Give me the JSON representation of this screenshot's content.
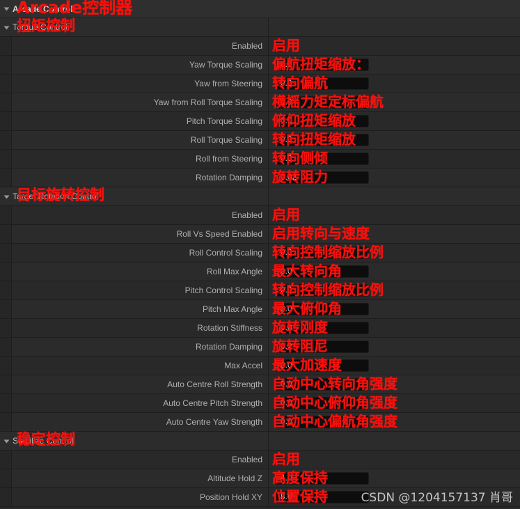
{
  "panel": {
    "title": "Arcade Control",
    "accent_annotation_color": "#f5110d",
    "background_color": "#282828",
    "field_background_color": "#0d0d0d"
  },
  "root": {
    "label": "Arcade Control",
    "annotation": "Arcade控制器",
    "expanded": true,
    "twisty_icon": "triangle-down-icon"
  },
  "rows": [
    {
      "kind": "category",
      "label": "Torque Control",
      "annotation": "扭矩控制",
      "twisty_icon": "triangle-down-icon",
      "control": "none",
      "value": ""
    },
    {
      "kind": "property",
      "label": "Enabled",
      "annotation": "启用",
      "control": "checkbox",
      "checked": false,
      "value": ""
    },
    {
      "kind": "property",
      "label": "Yaw Torque Scaling",
      "annotation": "偏航扭矩缩放：",
      "control": "number",
      "value": "0.0"
    },
    {
      "kind": "property",
      "label": "Yaw from Steering",
      "annotation": "转向偏航",
      "control": "number",
      "value": "0.0"
    },
    {
      "kind": "property",
      "label": "Yaw from Roll Torque Scaling",
      "annotation": "横摇力矩定标偏航",
      "control": "number",
      "value": "0.0"
    },
    {
      "kind": "property",
      "label": "Pitch Torque Scaling",
      "annotation": "俯仰扭矩缩放",
      "control": "number",
      "value": "0.0"
    },
    {
      "kind": "property",
      "label": "Roll Torque Scaling",
      "annotation": "转向扭矩缩放",
      "control": "number",
      "value": "0.0"
    },
    {
      "kind": "property",
      "label": "Roll from Steering",
      "annotation": "转向侧倾",
      "control": "number",
      "value": "0.0"
    },
    {
      "kind": "property",
      "label": "Rotation Damping",
      "annotation": "旋转阻力",
      "control": "number",
      "value": "0.02"
    },
    {
      "kind": "category",
      "label": "Target Rotation Control",
      "annotation": "目标旋转控制",
      "twisty_icon": "triangle-down-icon",
      "control": "none",
      "value": ""
    },
    {
      "kind": "property",
      "label": "Enabled",
      "annotation": "启用",
      "control": "checkbox",
      "checked": false,
      "value": ""
    },
    {
      "kind": "property",
      "label": "Roll Vs Speed Enabled",
      "annotation": "启用转向与速度",
      "control": "checkbox",
      "checked": false,
      "value": ""
    },
    {
      "kind": "property",
      "label": "Roll Control Scaling",
      "annotation": "转向控制缩放比例",
      "control": "number",
      "value": "0.0"
    },
    {
      "kind": "property",
      "label": "Roll Max Angle",
      "annotation": "最大转向角",
      "control": "number",
      "value": "0.0"
    },
    {
      "kind": "property",
      "label": "Pitch Control Scaling",
      "annotation": "转向控制缩放比例",
      "control": "number",
      "value": "0.0"
    },
    {
      "kind": "property",
      "label": "Pitch Max Angle",
      "annotation": "最大俯仰角",
      "control": "number",
      "value": "0.0"
    },
    {
      "kind": "property",
      "label": "Rotation Stiffness",
      "annotation": "旋转刚度",
      "control": "number",
      "value": "0.0"
    },
    {
      "kind": "property",
      "label": "Rotation Damping",
      "annotation": "旋转阻尼",
      "control": "number",
      "value": "0.2"
    },
    {
      "kind": "property",
      "label": "Max Accel",
      "annotation": "最大加速度",
      "control": "number",
      "value": "0.0"
    },
    {
      "kind": "property",
      "label": "Auto Centre Roll Strength",
      "annotation": "自动中心转向角强度",
      "control": "number",
      "value": "0.0"
    },
    {
      "kind": "property",
      "label": "Auto Centre Pitch Strength",
      "annotation": "自动中心俯仰角强度",
      "control": "number",
      "value": "0.0"
    },
    {
      "kind": "property",
      "label": "Auto Centre Yaw Strength",
      "annotation": "自动中心偏航角强度",
      "control": "number",
      "value": "0.0"
    },
    {
      "kind": "category",
      "label": "Stabilize Control",
      "annotation": "稳定控制",
      "twisty_icon": "triangle-down-icon",
      "control": "none",
      "value": ""
    },
    {
      "kind": "property",
      "label": "Enabled",
      "annotation": "启用",
      "control": "checkbox",
      "checked": false,
      "value": ""
    },
    {
      "kind": "property",
      "label": "Altitude Hold Z",
      "annotation": "高度保持",
      "control": "number",
      "value": "4.0"
    },
    {
      "kind": "property",
      "label": "Position Hold XY",
      "annotation": "位置保持",
      "control": "number",
      "value": "8.0"
    }
  ],
  "watermark": {
    "text": "CSDN @1204157137 肖哥"
  }
}
